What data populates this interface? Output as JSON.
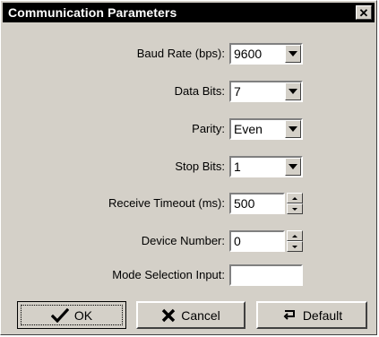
{
  "window": {
    "title": "Communication Parameters"
  },
  "fields": {
    "baud_rate": {
      "label": "Baud Rate (bps):",
      "value": "9600"
    },
    "data_bits": {
      "label": "Data Bits:",
      "value": "7"
    },
    "parity": {
      "label": "Parity:",
      "value": "Even"
    },
    "stop_bits": {
      "label": "Stop Bits:",
      "value": "1"
    },
    "receive_timeout": {
      "label": "Receive Timeout (ms):",
      "value": "500"
    },
    "device_number": {
      "label": "Device Number:",
      "value": "0"
    },
    "mode_selection": {
      "label": "Mode Selection Input:",
      "value": ""
    }
  },
  "buttons": {
    "ok": {
      "label": "OK",
      "icon": "checkmark-icon"
    },
    "cancel": {
      "label": "Cancel",
      "icon": "x-icon"
    },
    "default": {
      "label": "Default",
      "icon": "reset-icon"
    }
  },
  "colors": {
    "face": "#d4d0c8",
    "titlebar": "#000000",
    "titletext": "#ffffff"
  }
}
